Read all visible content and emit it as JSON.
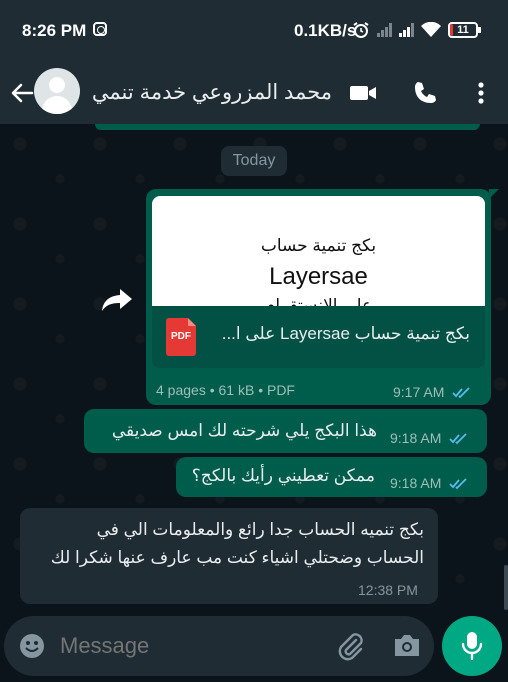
{
  "status_bar": {
    "time": "8:26 PM",
    "network_speed": "0.1KB/s",
    "battery": "11",
    "battery_level_percent": 11
  },
  "header": {
    "contact_name": "محمد المزروعي خدمة تنمي..."
  },
  "chat": {
    "date_label": "Today",
    "document_message": {
      "preview_line1": "بكج تنمية حساب",
      "preview_line2": "Layersae",
      "preview_line3": "على الانستقرام",
      "file_icon": "PDF",
      "file_title": "بكج تنمية حساب Layersae على ا...",
      "info": "4 pages • 61 kB • PDF",
      "time": "9:17 AM"
    },
    "messages": [
      {
        "direction": "out",
        "text": "هذا البكج يلي شرحته لك امس صديقي",
        "time": "9:18 AM"
      },
      {
        "direction": "out",
        "text": "ممكن تعطيني رأيك بالكج؟",
        "time": "9:18 AM"
      },
      {
        "direction": "in",
        "text_line1": "بكج تنميه الحساب جدا رائع والمعلومات الي في",
        "text_line2": "الحساب وضحتلي اشياء كنت مب عارف عنها شكرا لك",
        "time": "12:38 PM"
      }
    ]
  },
  "composer": {
    "placeholder": "Message"
  },
  "colors": {
    "outgoing_bubble": "#005c4b",
    "incoming_bubble": "#1f2c34",
    "accent": "#00a884",
    "read_ticks": "#53bdeb"
  }
}
